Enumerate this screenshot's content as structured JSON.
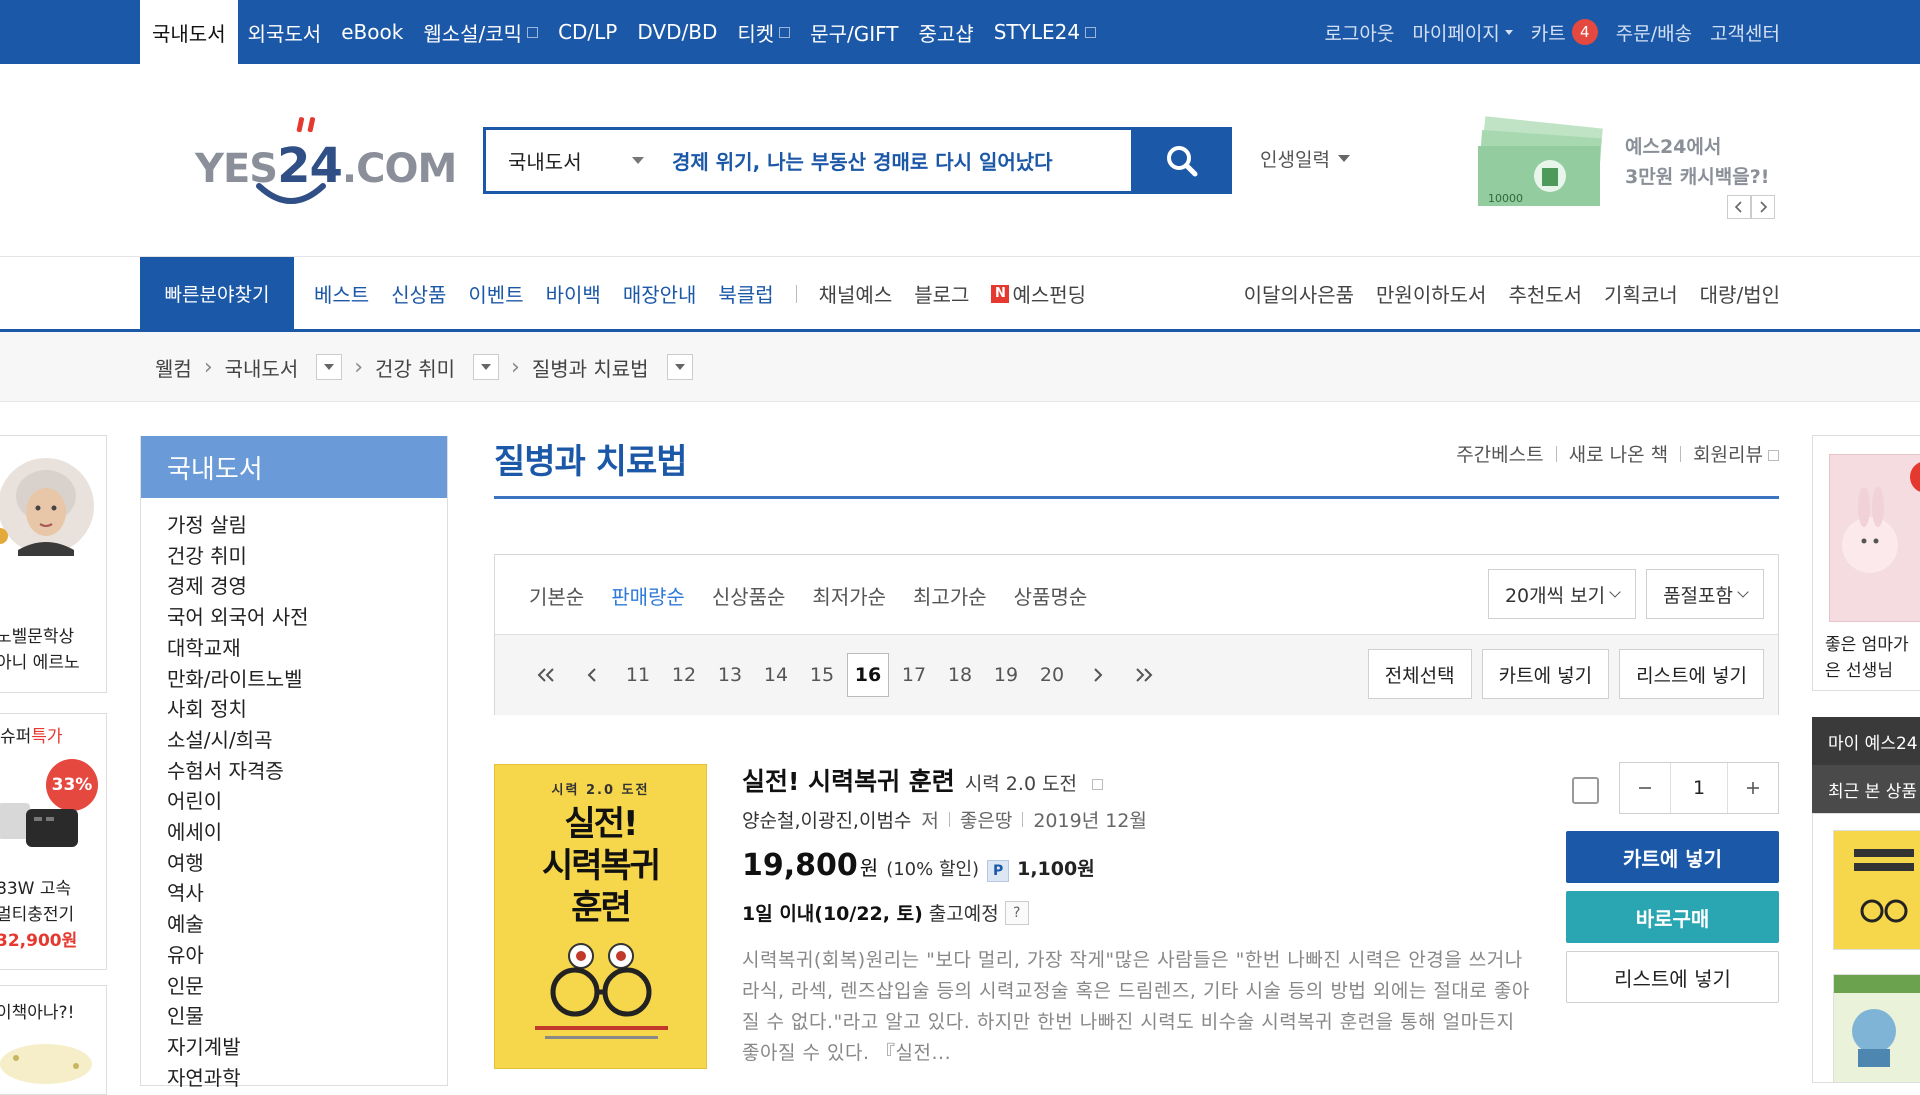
{
  "gnb": {
    "tabs": [
      {
        "label": "국내도서"
      },
      {
        "label": "외국도서"
      },
      {
        "label": "eBook"
      },
      {
        "label": "웹소설/코믹"
      },
      {
        "label": "CD/LP"
      },
      {
        "label": "DVD/BD"
      },
      {
        "label": "티켓"
      },
      {
        "label": "문구/GIFT"
      },
      {
        "label": "중고샵"
      },
      {
        "label": "STYLE24"
      }
    ],
    "right": {
      "logout": "로그아웃",
      "mypage": "마이페이지",
      "cart": "카트",
      "cart_count": "4",
      "order": "주문/배송",
      "support": "고객센터"
    }
  },
  "header": {
    "logo_text": "YES",
    "logo_num": "24",
    "logo_suffix": ".COM",
    "search_category": "국내도서",
    "search_value": "경제 위기, 나는 부동산 경매로 다시 일어났다",
    "life_input": "인생일력",
    "promo_line1": "예스24에서",
    "promo_line2": "3만원 캐시백을?!",
    "promo_bill": "10000"
  },
  "catnav": {
    "quick": "빠른분야찾기",
    "left_blue": [
      "베스트",
      "신상품",
      "이벤트",
      "바이백",
      "매장안내",
      "북클럽"
    ],
    "left_gray": [
      "채널예스",
      "블로그"
    ],
    "funding": "예스펀딩",
    "right": [
      "이달의사은품",
      "만원이하도서",
      "추천도서",
      "기획코너",
      "대량/법인"
    ]
  },
  "breadcrumb": [
    "웰컴",
    "국내도서",
    "건강 취미",
    "질병과 치료법"
  ],
  "left_float": {
    "a_lines": [
      "노벨문학상",
      "아니 에르노"
    ],
    "b_label1": "슈퍼",
    "b_label2": "특가",
    "b_discount": "33%",
    "b_lines": [
      "83W 고속",
      "멀티충전기"
    ],
    "b_price": "32,900원",
    "c_line": "이책아나?!"
  },
  "sidebar": {
    "title": "국내도서",
    "items": [
      "가정 살림",
      "건강 취미",
      "경제 경영",
      "국어 외국어 사전",
      "대학교재",
      "만화/라이트노벨",
      "사회 정치",
      "소설/시/희곡",
      "수험서 자격증",
      "어린이",
      "에세이",
      "여행",
      "역사",
      "예술",
      "유아",
      "인문",
      "인물",
      "자기계발",
      "자연과학"
    ]
  },
  "main": {
    "title": "질병과 치료법",
    "title_links": [
      "주간베스트",
      "새로 나온 책",
      "회원리뷰"
    ],
    "sort_options": [
      "기본순",
      "판매량순",
      "신상품순",
      "최저가순",
      "최고가순",
      "상품명순"
    ],
    "active_sort": "판매량순",
    "per_page": "20개씩 보기",
    "soldout": "품절포함",
    "pages": [
      "11",
      "12",
      "13",
      "14",
      "15",
      "16",
      "17",
      "18",
      "19",
      "20"
    ],
    "current_page": "16",
    "select_all": "전체선택",
    "add_cart": "카트에 넣기",
    "add_list": "리스트에 넣기"
  },
  "product": {
    "cover_sub": "시력 2.0 도전",
    "cover_title1": "실전!",
    "cover_title2": "시력복귀",
    "cover_title3": "훈련",
    "title": "실전! 시력복귀 훈련",
    "subtitle": "시력 2.0 도전",
    "authors": "양순철,이광진,이범수",
    "author_role": "저",
    "publisher": "좋은땅",
    "date": "2019년 12월",
    "price": "19,800",
    "price_unit": "원",
    "discount": "(10% 할인)",
    "point_icon": "P",
    "point": "1,100원",
    "ship_bold": "1일 이내(10/22, 토)",
    "ship_rest": "출고예정",
    "description": "시력복귀(회복)원리는 \"보다 멀리, 가장 작게\"많은 사람들은 \"한번 나빠진 시력은 안경을 쓰거나 라식, 라섹, 렌즈삽입술 등의 시력교정술 혹은 드림렌즈, 기타 시술 등의 방법 외에는 절대로 좋아질 수 없다.\"라고 알고 있다. 하지만 한번 나빠진 시력도 비수술 시력복귀 훈련을 통해 얼마든지 좋아질 수 있다. 『실전...",
    "quantity": "1",
    "btn_cart": "카트에 넣기",
    "btn_buy": "바로구매",
    "btn_list": "리스트에 넣기"
  },
  "right_float": {
    "book_lines": [
      "좋은 엄마가",
      "은 선생님"
    ],
    "my_yes24": "마이 예스24",
    "recent": "최근 본 상품"
  },
  "colors": {
    "brand_blue": "#1c58a8",
    "buy_teal": "#2aa6b3",
    "badge_red": "#e5483f"
  }
}
